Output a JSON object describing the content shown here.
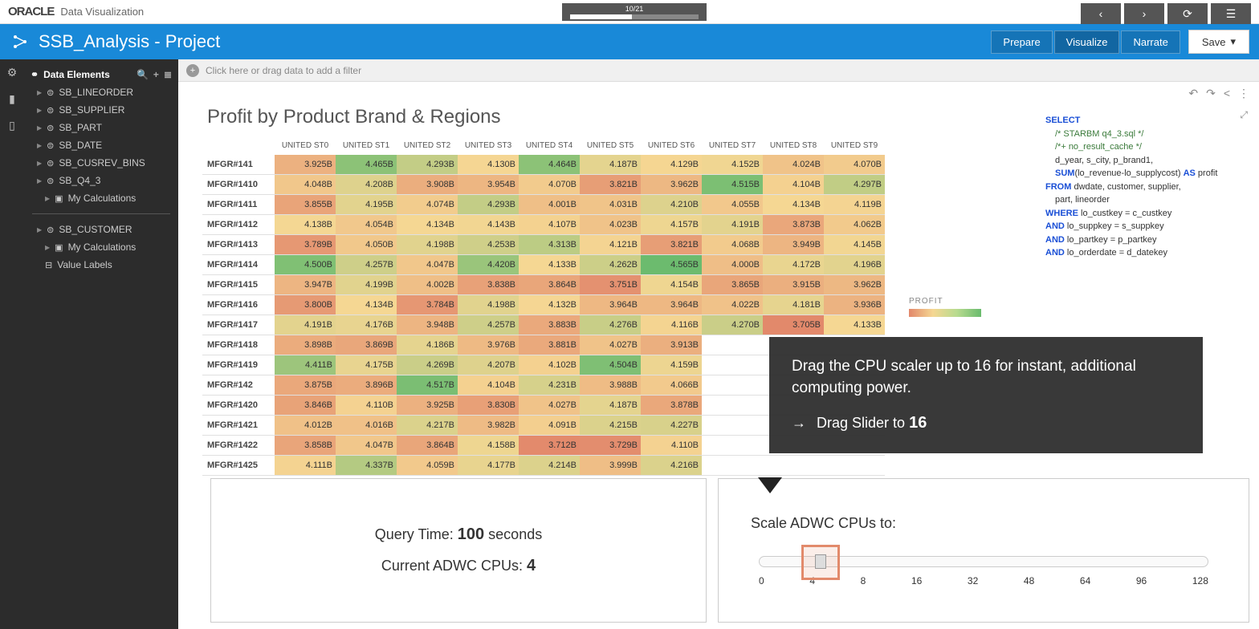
{
  "app": {
    "brand": "ORACLE",
    "name": "Data Visualization"
  },
  "progress": {
    "label": "10/21"
  },
  "nav": {
    "back": "‹",
    "forward": "›",
    "reload": "⟳",
    "menu": "☰"
  },
  "header": {
    "title": "SSB_Analysis - Project",
    "modes": {
      "prepare": "Prepare",
      "visualize": "Visualize",
      "narrate": "Narrate"
    },
    "save": "Save"
  },
  "sidebar": {
    "title": "Data Elements",
    "group1": {
      "items": [
        "SB_LINEORDER",
        "SB_SUPPLIER",
        "SB_PART",
        "SB_DATE",
        "SB_CUSREV_BINS",
        "SB_Q4_3"
      ],
      "calc": "My Calculations"
    },
    "group2": {
      "items": [
        "SB_CUSTOMER"
      ],
      "calc": "My Calculations",
      "labels": "Value Labels"
    }
  },
  "filter_hint": "Click here or drag data to add a filter",
  "chart_title": "Profit by Product Brand & Regions",
  "legend_title": "PROFIT",
  "chart_data": {
    "type": "heatmap",
    "columns": [
      "UNITED ST0",
      "UNITED ST1",
      "UNITED ST2",
      "UNITED ST3",
      "UNITED ST4",
      "UNITED ST5",
      "UNITED ST6",
      "UNITED ST7",
      "UNITED ST8",
      "UNITED ST9"
    ],
    "rows": [
      {
        "label": "MFGR#141",
        "v": [
          "3.925B",
          "4.465B",
          "4.293B",
          "4.130B",
          "4.464B",
          "4.187B",
          "4.129B",
          "4.152B",
          "4.024B",
          "4.070B"
        ]
      },
      {
        "label": "MFGR#1410",
        "v": [
          "4.048B",
          "4.208B",
          "3.908B",
          "3.954B",
          "4.070B",
          "3.821B",
          "3.962B",
          "4.515B",
          "4.104B",
          "4.297B"
        ]
      },
      {
        "label": "MFGR#1411",
        "v": [
          "3.855B",
          "4.195B",
          "4.074B",
          "4.293B",
          "4.001B",
          "4.031B",
          "4.210B",
          "4.055B",
          "4.134B",
          "4.119B"
        ]
      },
      {
        "label": "MFGR#1412",
        "v": [
          "4.138B",
          "4.054B",
          "4.134B",
          "4.143B",
          "4.107B",
          "4.023B",
          "4.157B",
          "4.191B",
          "3.873B",
          "4.062B"
        ]
      },
      {
        "label": "MFGR#1413",
        "v": [
          "3.789B",
          "4.050B",
          "4.198B",
          "4.253B",
          "4.313B",
          "4.121B",
          "3.821B",
          "4.068B",
          "3.949B",
          "4.145B"
        ]
      },
      {
        "label": "MFGR#1414",
        "v": [
          "4.500B",
          "4.257B",
          "4.047B",
          "4.420B",
          "4.133B",
          "4.262B",
          "4.565B",
          "4.000B",
          "4.172B",
          "4.196B"
        ]
      },
      {
        "label": "MFGR#1415",
        "v": [
          "3.947B",
          "4.199B",
          "4.002B",
          "3.838B",
          "3.864B",
          "3.751B",
          "4.154B",
          "3.865B",
          "3.915B",
          "3.962B"
        ]
      },
      {
        "label": "MFGR#1416",
        "v": [
          "3.800B",
          "4.134B",
          "3.784B",
          "4.198B",
          "4.132B",
          "3.964B",
          "3.964B",
          "4.022B",
          "4.181B",
          "3.936B"
        ]
      },
      {
        "label": "MFGR#1417",
        "v": [
          "4.191B",
          "4.176B",
          "3.948B",
          "4.257B",
          "3.883B",
          "4.276B",
          "4.116B",
          "4.270B",
          "3.705B",
          "4.133B"
        ]
      },
      {
        "label": "MFGR#1418",
        "v": [
          "3.898B",
          "3.869B",
          "4.186B",
          "3.976B",
          "3.881B",
          "4.027B",
          "3.913B",
          "",
          "",
          ""
        ]
      },
      {
        "label": "MFGR#1419",
        "v": [
          "4.411B",
          "4.175B",
          "4.269B",
          "4.207B",
          "4.102B",
          "4.504B",
          "4.159B",
          "",
          "",
          ""
        ]
      },
      {
        "label": "MFGR#142",
        "v": [
          "3.875B",
          "3.896B",
          "4.517B",
          "4.104B",
          "4.231B",
          "3.988B",
          "4.066B",
          "",
          "",
          ""
        ]
      },
      {
        "label": "MFGR#1420",
        "v": [
          "3.846B",
          "4.110B",
          "3.925B",
          "3.830B",
          "4.027B",
          "4.187B",
          "3.878B",
          "",
          "",
          ""
        ]
      },
      {
        "label": "MFGR#1421",
        "v": [
          "4.012B",
          "4.016B",
          "4.217B",
          "3.982B",
          "4.091B",
          "4.215B",
          "4.227B",
          "",
          "",
          ""
        ]
      },
      {
        "label": "MFGR#1422",
        "v": [
          "3.858B",
          "4.047B",
          "3.864B",
          "4.158B",
          "3.712B",
          "3.729B",
          "4.110B",
          "",
          "",
          ""
        ]
      },
      {
        "label": "MFGR#1425",
        "v": [
          "4.111B",
          "4.337B",
          "4.059B",
          "4.177B",
          "4.214B",
          "3.999B",
          "4.216B",
          "",
          "",
          ""
        ]
      }
    ]
  },
  "sql": {
    "select": "SELECT",
    "cmt1": "/* STARBM q4_3.sql */",
    "cmt2": "/*+ no_result_cache */",
    "l1": "d_year, s_city, p_brand1,",
    "sum": "SUM",
    "l2": "(lo_revenue-lo_supplycost) ",
    "as": "AS",
    "l2b": " profit",
    "from": "FROM",
    "l3": " dwdate, customer, supplier,",
    "l4": "part, lineorder",
    "where": "WHERE",
    "l5": " lo_custkey = c_custkey",
    "and": "AND",
    "l6": " lo_suppkey  = s_suppkey",
    "l7": " lo_partkey  = p_partkey",
    "l8": " lo_orderdate = d_datekey"
  },
  "metrics": {
    "query_label": "Query Time: ",
    "query_val": "100",
    "query_unit": " seconds",
    "cpu_label": "Current ADWC CPUs: ",
    "cpu_val": "4"
  },
  "slider": {
    "title": "Scale ADWC CPUs to:",
    "ticks": [
      "0",
      "4",
      "8",
      "16",
      "32",
      "48",
      "64",
      "96",
      "128"
    ]
  },
  "tooltip": {
    "text": "Drag the CPU scaler up to 16 for instant, additional computing power.",
    "action_prefix": "Drag Slider to ",
    "action_val": "16"
  }
}
